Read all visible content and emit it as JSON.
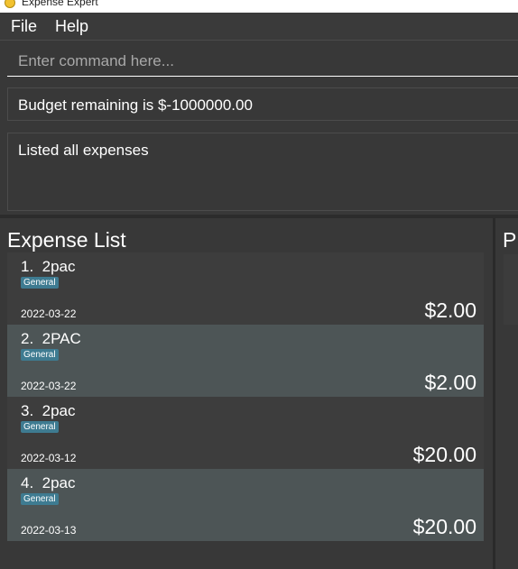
{
  "window": {
    "title": "Expense Expert"
  },
  "menu": {
    "file": "File",
    "help": "Help"
  },
  "command": {
    "placeholder": "Enter command here..."
  },
  "budget": {
    "text": "Budget remaining is $-1000000.00"
  },
  "result": {
    "text": "Listed all expenses"
  },
  "expense_list": {
    "heading": "Expense List",
    "items": [
      {
        "index": "1.",
        "name": "2pac",
        "tag": "General",
        "date": "2022-03-22",
        "amount": "$2.00"
      },
      {
        "index": "2.",
        "name": "2PAC",
        "tag": "General",
        "date": "2022-03-22",
        "amount": "$2.00"
      },
      {
        "index": "3.",
        "name": "2pac",
        "tag": "General",
        "date": "2022-03-12",
        "amount": "$20.00"
      },
      {
        "index": "4.",
        "name": "2pac",
        "tag": "General",
        "date": "2022-03-13",
        "amount": "$20.00"
      }
    ]
  },
  "right_panel": {
    "heading": "P"
  },
  "colors": {
    "tag_bg": "#3e7b91",
    "card_alt_bg": "#4d5556",
    "bg": "#383838"
  }
}
